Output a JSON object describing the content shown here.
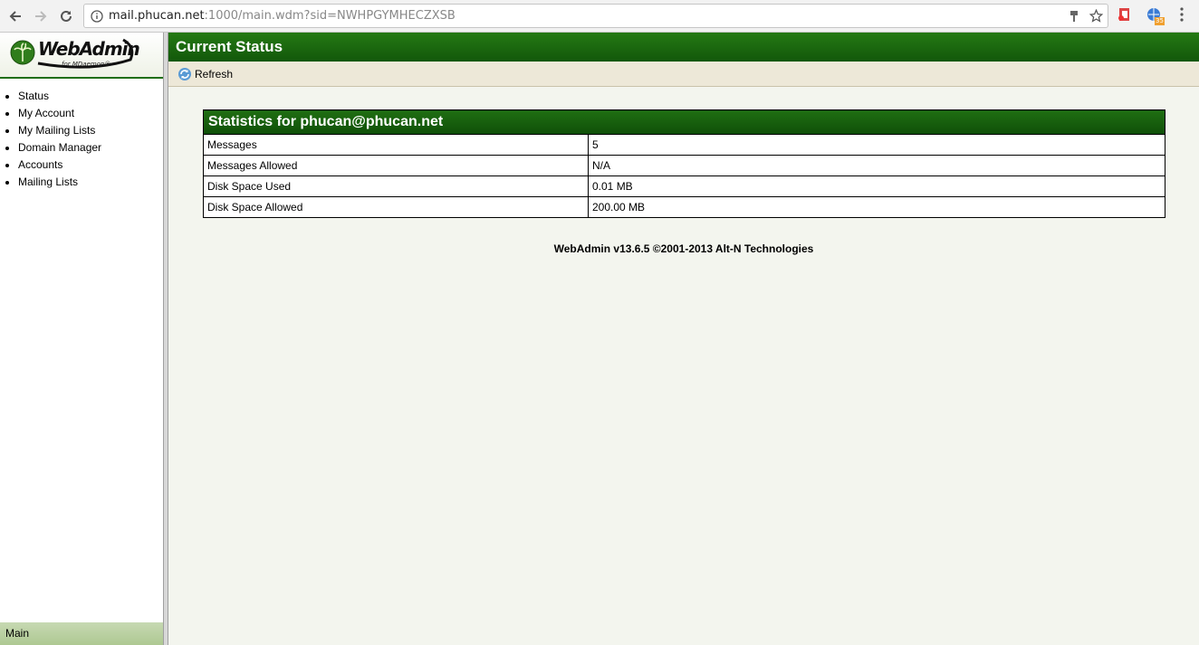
{
  "browser": {
    "url_host": "mail.phucan.net",
    "url_rest": ":1000/main.wdm?sid=NWHPGYMHECZXSB",
    "extension_badge": "35"
  },
  "logo": {
    "name": "WebAdmin",
    "sub": "for MDaemon®"
  },
  "nav": {
    "items": [
      "Status",
      "My Account",
      "My Mailing Lists",
      "Domain Manager",
      "Accounts",
      "Mailing Lists"
    ]
  },
  "left_footer": "Main",
  "main": {
    "title": "Current Status",
    "refresh_label": "Refresh",
    "stats_title": "Statistics for phucan@phucan.net",
    "rows": [
      {
        "label": "Messages",
        "value": "5"
      },
      {
        "label": "Messages Allowed",
        "value": "N/A"
      },
      {
        "label": "Disk Space Used",
        "value": "0.01 MB"
      },
      {
        "label": "Disk Space Allowed",
        "value": "200.00 MB"
      }
    ],
    "footer": "WebAdmin v13.6.5 ©2001-2013 Alt-N Technologies"
  },
  "colors": {
    "header_green": "#1a6410",
    "toolbar_beige": "#ede8d8",
    "page_bg": "#f3f5ee"
  }
}
